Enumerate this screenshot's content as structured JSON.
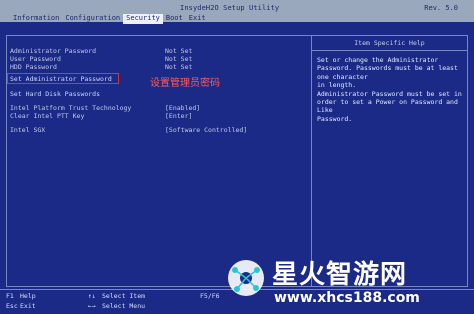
{
  "header": {
    "title": "InsydeH2O Setup Utility",
    "revision": "Rev. 5.0"
  },
  "tabs": [
    {
      "label": "Information"
    },
    {
      "label": "Configuration"
    },
    {
      "label": "Security"
    },
    {
      "label": "Boot"
    },
    {
      "label": "Exit"
    }
  ],
  "main": {
    "status_rows": [
      {
        "label": "Administrator Password",
        "value": "Not Set"
      },
      {
        "label": "User Password",
        "value": "Not Set"
      },
      {
        "label": "HDD Password",
        "value": "Not Set"
      }
    ],
    "set_admin_password": "Set Administrator Password",
    "set_hdd_passwords": "Set Hard Disk Passwords",
    "intel_ptt": {
      "label": "Intel Platform Trust Technology",
      "value": "[Enabled]"
    },
    "clear_ptt": {
      "label": "Clear Intel PTT Key",
      "value": "[Enter]"
    },
    "intel_sgx": {
      "label": "Intel SGX",
      "value": "[Software Controlled]"
    }
  },
  "annotation": "设置管理员密码",
  "help": {
    "heading": "Item Specific Help",
    "lines": [
      "Set or change the Administrator",
      "Password. Passwords must be at least one character",
      "in length.",
      "Administrator Password must be set in",
      "order to set a Power on Password and Like",
      "Password."
    ]
  },
  "footer": {
    "f1": "F1",
    "help": "Help",
    "esc": "Esc",
    "exit": "Exit",
    "select_item": "Select Item",
    "select_menu": "Select Menu",
    "f5f6": "F5/F6"
  },
  "watermark": {
    "title": "星火智游网",
    "url": "www.xhcs188.com"
  },
  "colors": {
    "background": "#1b2a86",
    "titlebar": "#9aa8bd",
    "highlight_box": "#e03030"
  }
}
